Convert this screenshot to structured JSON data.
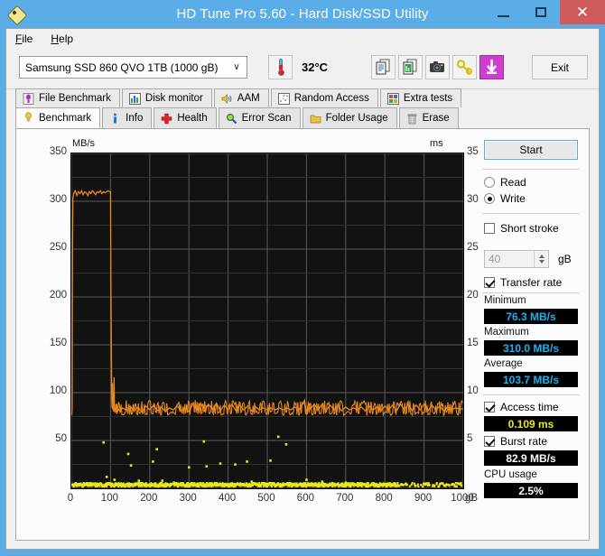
{
  "window": {
    "title": "HD Tune Pro 5.60 - Hard Disk/SSD Utility",
    "icon": "hdtune-diamond-icon",
    "minimize_label": "–",
    "maximize_label": "□",
    "close_label": "✕"
  },
  "menu": {
    "items": [
      {
        "label": "File",
        "accel": "F"
      },
      {
        "label": "Help",
        "accel": "H"
      }
    ]
  },
  "toolbar": {
    "drive": {
      "selected": "Samsung SSD 860 QVO 1TB (1000 gB)",
      "arrow": "∨"
    },
    "temperature": "32°C",
    "buttons": [
      {
        "name": "copy-text-button",
        "icon": "copy-document-icon"
      },
      {
        "name": "copy-graph-button",
        "icon": "copy-image-icon"
      },
      {
        "name": "screenshot-button",
        "icon": "camera-icon"
      },
      {
        "name": "settings-button",
        "icon": "key-icon"
      },
      {
        "name": "download-button",
        "icon": "download-arrow-icon"
      }
    ],
    "exit_label": "Exit"
  },
  "tabs": {
    "top_row": [
      {
        "label": "File Benchmark",
        "icon": "bulb-purple-icon"
      },
      {
        "label": "Disk monitor",
        "icon": "bar-chart-icon"
      },
      {
        "label": "AAM",
        "icon": "speaker-icon"
      },
      {
        "label": "Random Access",
        "icon": "scatter-icon"
      },
      {
        "label": "Extra tests",
        "icon": "grid-chart-icon"
      }
    ],
    "bottom_row": [
      {
        "label": "Benchmark",
        "icon": "bulb-yellow-icon",
        "active": true
      },
      {
        "label": "Info",
        "icon": "info-icon",
        "active": false
      },
      {
        "label": "Health",
        "icon": "red-cross-icon",
        "active": false
      },
      {
        "label": "Error Scan",
        "icon": "magnifier-icon",
        "active": false
      },
      {
        "label": "Folder Usage",
        "icon": "folder-icon",
        "active": false
      },
      {
        "label": "Erase",
        "icon": "trash-icon",
        "active": false
      }
    ]
  },
  "side_panel": {
    "start_label": "Start",
    "mode": {
      "read_label": "Read",
      "write_label": "Write",
      "selected": "Write"
    },
    "short_stroke": {
      "label": "Short stroke",
      "checked": false,
      "value": "40",
      "unit": "gB"
    },
    "transfer_rate": {
      "label": "Transfer rate",
      "checked": true,
      "minimum_label": "Minimum",
      "minimum_value": "76.3 MB/s",
      "maximum_label": "Maximum",
      "maximum_value": "310.0 MB/s",
      "average_label": "Average",
      "average_value": "103.7 MB/s"
    },
    "access_time": {
      "label": "Access time",
      "checked": true,
      "value": "0.109 ms"
    },
    "burst_rate": {
      "label": "Burst rate",
      "checked": true,
      "value": "82.9 MB/s"
    },
    "cpu_usage": {
      "label": "CPU usage",
      "value": "2.5%"
    }
  },
  "colors": {
    "title_bar": "#5aade6",
    "close_button": "#d05b5b",
    "plot_background": "#121212",
    "gridline": "#555555",
    "transfer_rate_line": "#e8871e",
    "access_time_dots": "#e8e81e",
    "value_cyan": "#18b4f0",
    "value_yellow": "#e8e81e",
    "accent_button": "#cf3fcf"
  },
  "chart_data": {
    "type": "line",
    "title": "",
    "xlabel": "gB",
    "ylabel": "MB/s",
    "y2label": "ms",
    "xlim": [
      0,
      1000
    ],
    "ylim": [
      0,
      350
    ],
    "y2lim": [
      0,
      35
    ],
    "grid": true,
    "x_ticks": [
      0,
      100,
      200,
      300,
      400,
      500,
      600,
      700,
      800,
      900,
      1000
    ],
    "x_tick_labels": [
      "0",
      "100",
      "200",
      "300",
      "400",
      "500",
      "600",
      "700",
      "800",
      "900",
      "1000"
    ],
    "x_unit_suffix": "gB",
    "y_ticks": [
      50,
      100,
      150,
      200,
      250,
      300,
      350
    ],
    "y_tick_labels": [
      "50",
      "100",
      "150",
      "200",
      "250",
      "300",
      "350"
    ],
    "y2_ticks": [
      5,
      10,
      15,
      20,
      25,
      30,
      35
    ],
    "y2_tick_labels": [
      "5",
      "10",
      "15",
      "20",
      "25",
      "30",
      "35"
    ],
    "series": [
      {
        "name": "Transfer rate",
        "axis": "left",
        "unit": "MB/s",
        "color": "#e8871e",
        "points": [
          [
            0,
            78
          ],
          [
            1,
            76
          ],
          [
            2,
            84
          ],
          [
            3,
            250
          ],
          [
            4,
            303
          ],
          [
            6,
            308
          ],
          [
            10,
            311
          ],
          [
            14,
            306
          ],
          [
            18,
            310
          ],
          [
            22,
            308
          ],
          [
            26,
            311
          ],
          [
            30,
            307
          ],
          [
            34,
            310
          ],
          [
            38,
            309
          ],
          [
            42,
            306
          ],
          [
            46,
            310
          ],
          [
            50,
            308
          ],
          [
            54,
            311
          ],
          [
            58,
            309
          ],
          [
            62,
            307
          ],
          [
            66,
            310
          ],
          [
            70,
            309
          ],
          [
            74,
            311
          ],
          [
            78,
            308
          ],
          [
            82,
            310
          ],
          [
            86,
            309
          ],
          [
            90,
            310
          ],
          [
            94,
            311
          ],
          [
            98,
            310
          ],
          [
            100,
            310
          ],
          [
            101,
            215
          ],
          [
            102,
            160
          ],
          [
            103,
            96
          ],
          [
            104,
            84
          ],
          [
            105,
            110
          ],
          [
            106,
            82
          ],
          [
            107,
            100
          ],
          [
            108,
            80
          ],
          [
            109,
            116
          ],
          [
            110,
            83
          ],
          [
            112,
            79
          ],
          [
            114,
            88
          ],
          [
            116,
            78
          ],
          [
            120,
            83
          ],
          [
            125,
            80
          ],
          [
            130,
            84
          ],
          [
            140,
            82
          ],
          [
            150,
            86
          ],
          [
            160,
            81
          ],
          [
            170,
            85
          ],
          [
            180,
            80
          ],
          [
            190,
            86
          ],
          [
            200,
            82
          ],
          [
            210,
            87
          ],
          [
            220,
            81
          ],
          [
            230,
            85
          ],
          [
            240,
            80
          ],
          [
            250,
            84
          ],
          [
            260,
            82
          ],
          [
            270,
            86
          ],
          [
            280,
            81
          ],
          [
            290,
            84
          ],
          [
            300,
            80
          ],
          [
            310,
            88
          ],
          [
            320,
            82
          ],
          [
            330,
            89
          ],
          [
            340,
            81
          ],
          [
            350,
            88
          ],
          [
            360,
            82
          ],
          [
            370,
            89
          ],
          [
            380,
            81
          ],
          [
            390,
            87
          ],
          [
            400,
            82
          ],
          [
            410,
            88
          ],
          [
            420,
            81
          ],
          [
            430,
            87
          ],
          [
            440,
            82
          ],
          [
            450,
            86
          ],
          [
            460,
            81
          ],
          [
            470,
            85
          ],
          [
            480,
            82
          ],
          [
            490,
            84
          ],
          [
            500,
            82
          ],
          [
            510,
            84
          ],
          [
            520,
            82
          ],
          [
            530,
            84
          ],
          [
            540,
            82
          ],
          [
            550,
            84
          ],
          [
            560,
            82
          ],
          [
            570,
            85
          ],
          [
            580,
            82
          ],
          [
            590,
            88
          ],
          [
            595,
            92
          ],
          [
            600,
            78
          ],
          [
            605,
            89
          ],
          [
            610,
            83
          ],
          [
            620,
            88
          ],
          [
            630,
            82
          ],
          [
            640,
            88
          ],
          [
            650,
            81
          ],
          [
            660,
            87
          ],
          [
            670,
            82
          ],
          [
            680,
            86
          ],
          [
            690,
            81
          ],
          [
            700,
            85
          ],
          [
            710,
            82
          ],
          [
            720,
            84
          ],
          [
            730,
            82
          ],
          [
            740,
            85
          ],
          [
            750,
            81
          ],
          [
            760,
            86
          ],
          [
            770,
            82
          ],
          [
            780,
            85
          ],
          [
            790,
            81
          ],
          [
            800,
            86
          ],
          [
            810,
            82
          ],
          [
            820,
            87
          ],
          [
            830,
            81
          ],
          [
            840,
            88
          ],
          [
            850,
            82
          ],
          [
            860,
            88
          ],
          [
            870,
            81
          ],
          [
            880,
            87
          ],
          [
            890,
            82
          ],
          [
            900,
            88
          ],
          [
            910,
            81
          ],
          [
            920,
            87
          ],
          [
            930,
            82
          ],
          [
            940,
            86
          ],
          [
            950,
            81
          ],
          [
            960,
            85
          ],
          [
            970,
            82
          ],
          [
            980,
            84
          ],
          [
            990,
            83
          ],
          [
            1000,
            83
          ]
        ]
      },
      {
        "name": "Access time",
        "axis": "right",
        "unit": "ms",
        "color": "#e8e81e",
        "style": "scatter",
        "baseline_ms": 0.109,
        "outliers": [
          [
            82,
            4.8
          ],
          [
            90,
            1.2
          ],
          [
            110,
            0.9
          ],
          [
            145,
            3.6
          ],
          [
            152,
            2.4
          ],
          [
            172,
            0.8
          ],
          [
            208,
            2.8
          ],
          [
            218,
            4.1
          ],
          [
            232,
            0.8
          ],
          [
            262,
            0.6
          ],
          [
            300,
            2.2
          ],
          [
            338,
            4.9
          ],
          [
            345,
            2.3
          ],
          [
            380,
            2.6
          ],
          [
            418,
            2.5
          ],
          [
            448,
            2.8
          ],
          [
            460,
            0.7
          ],
          [
            508,
            2.9
          ],
          [
            528,
            5.4
          ],
          [
            548,
            4.6
          ],
          [
            600,
            0.9
          ],
          [
            640,
            0.7
          ],
          [
            700,
            0.6
          ]
        ]
      }
    ]
  }
}
